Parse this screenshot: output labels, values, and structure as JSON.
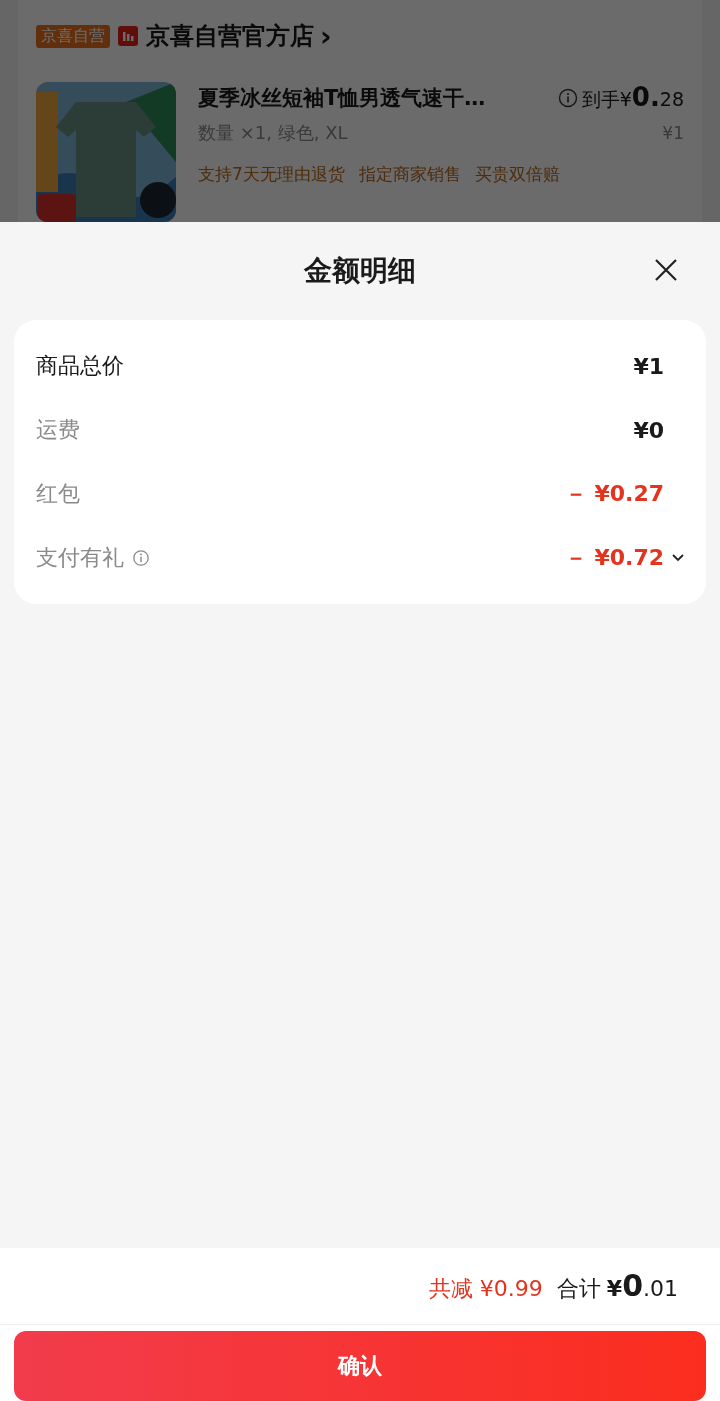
{
  "store": {
    "badge": "京喜自营",
    "name": "京喜自营官方店",
    "chevron": "›"
  },
  "product": {
    "title": "夏季冰丝短袖T恤男透气速干…",
    "price_label": "到手",
    "price_currency": "¥",
    "price_main": "0.",
    "price_fraction": "28",
    "spec": "数量 ×1, 绿色, XL",
    "original_price": "¥1",
    "tags": [
      "支持7天无理由退货",
      "指定商家销售",
      "买贵双倍赔"
    ]
  },
  "sheet": {
    "title": "金额明细",
    "rows": [
      {
        "kind": "total",
        "label": "商品总价",
        "value": "¥1",
        "info": false,
        "expandable": false
      },
      {
        "kind": "fee",
        "label": "运费",
        "value": "¥0",
        "info": false,
        "expandable": false
      },
      {
        "kind": "discount",
        "label": "红包",
        "value": "－ ¥0.27",
        "info": false,
        "expandable": false
      },
      {
        "kind": "discount",
        "label": "支付有礼",
        "value": "－ ¥0.72",
        "info": true,
        "expandable": true
      }
    ]
  },
  "footer": {
    "saved": "共减 ¥0.99",
    "total_label": "合计",
    "total_currency": "¥",
    "total_main": "0",
    "total_fraction": ".01",
    "confirm": "确认"
  }
}
